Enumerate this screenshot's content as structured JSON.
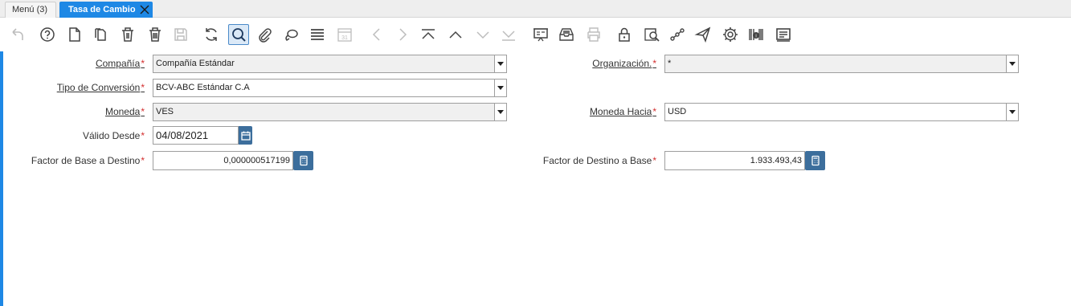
{
  "tabs": [
    {
      "label": "Menú (3)"
    },
    {
      "label": "Tasa de Cambio"
    }
  ],
  "toolbar": {
    "icons": [
      "undo-icon",
      "help-icon",
      "new-record-icon",
      "copy-record-icon",
      "delete-icon",
      "delete-selection-icon",
      "save-icon",
      "refresh-icon",
      "find-icon",
      "attachment-icon",
      "chat-icon",
      "toggle-grid-icon",
      "calendar-icon",
      "prev-icon",
      "next-icon",
      "first-record-icon",
      "previous-record-icon",
      "next-record-icon",
      "last-record-icon",
      "report-icon",
      "archive-icon",
      "print-icon",
      "lock-icon",
      "zoom-across-icon",
      "workflow-icon",
      "send-icon",
      "process-icon",
      "product-info-icon",
      "document-icon"
    ]
  },
  "form": {
    "compania": {
      "label": "Compañía",
      "value": "Compañía Estándar"
    },
    "organizacion": {
      "label": "Organización.",
      "value": "*"
    },
    "tipo_conversion": {
      "label": "Tipo de Conversión",
      "value": "BCV-ABC Estándar C.A"
    },
    "moneda": {
      "label": "Moneda",
      "value": "VES"
    },
    "moneda_hacia": {
      "label": "Moneda Hacia",
      "value": "USD"
    },
    "valido_desde": {
      "label": "Válido Desde",
      "value": "04/08/2021"
    },
    "factor_base_destino": {
      "label": "Factor de Base a Destino",
      "value": "0,000000517199"
    },
    "factor_destino_base": {
      "label": "Factor de Destino a Base",
      "value": "1.933.493,43"
    },
    "required_marker": "*"
  },
  "colors": {
    "accent": "#1e88e5",
    "button": "#3c6e9c",
    "required": "#d32f2f"
  }
}
